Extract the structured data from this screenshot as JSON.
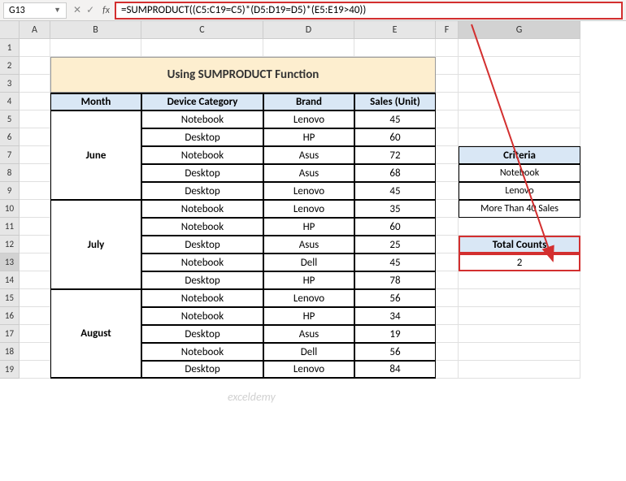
{
  "name_box": "G13",
  "fx_label": "fx",
  "formula": "=SUMPRODUCT((C5:C19=C5)*(D5:D19=D5)*(E5:E19>40))",
  "col_headers": [
    "A",
    "B",
    "C",
    "D",
    "E",
    "F",
    "G"
  ],
  "row_headers": [
    "1",
    "2",
    "3",
    "4",
    "5",
    "6",
    "7",
    "8",
    "9",
    "10",
    "11",
    "12",
    "13",
    "14",
    "15",
    "16",
    "17",
    "18",
    "19"
  ],
  "title": "Using SUMPRODUCT Function",
  "table": {
    "headers": [
      "Month",
      "Device Category",
      "Brand",
      "Sales (Unit)"
    ],
    "months": [
      "June",
      "July",
      "August"
    ],
    "rows": [
      {
        "m": 0,
        "cat": "Notebook",
        "brand": "Lenovo",
        "sales": "45"
      },
      {
        "m": 0,
        "cat": "Desktop",
        "brand": "HP",
        "sales": "60"
      },
      {
        "m": 0,
        "cat": "Notebook",
        "brand": "Asus",
        "sales": "72"
      },
      {
        "m": 0,
        "cat": "Desktop",
        "brand": "Asus",
        "sales": "68"
      },
      {
        "m": 0,
        "cat": "Desktop",
        "brand": "Lenovo",
        "sales": "45"
      },
      {
        "m": 1,
        "cat": "Notebook",
        "brand": "Lenovo",
        "sales": "35"
      },
      {
        "m": 1,
        "cat": "Notebook",
        "brand": "HP",
        "sales": "60"
      },
      {
        "m": 1,
        "cat": "Desktop",
        "brand": "Asus",
        "sales": "25"
      },
      {
        "m": 1,
        "cat": "Notebook",
        "brand": "Dell",
        "sales": "45"
      },
      {
        "m": 1,
        "cat": "Desktop",
        "brand": "HP",
        "sales": "78"
      },
      {
        "m": 2,
        "cat": "Notebook",
        "brand": "Lenovo",
        "sales": "56"
      },
      {
        "m": 2,
        "cat": "Notebook",
        "brand": "HP",
        "sales": "34"
      },
      {
        "m": 2,
        "cat": "Desktop",
        "brand": "Asus",
        "sales": "19"
      },
      {
        "m": 2,
        "cat": "Notebook",
        "brand": "Dell",
        "sales": "56"
      },
      {
        "m": 2,
        "cat": "Desktop",
        "brand": "Lenovo",
        "sales": "84"
      }
    ]
  },
  "criteria": {
    "header": "Criteria",
    "items": [
      "Notebook",
      "Lenovo",
      "More Than 40 Sales"
    ]
  },
  "counts": {
    "header": "Total Counts",
    "value": "2"
  },
  "watermark": "exceldemy"
}
